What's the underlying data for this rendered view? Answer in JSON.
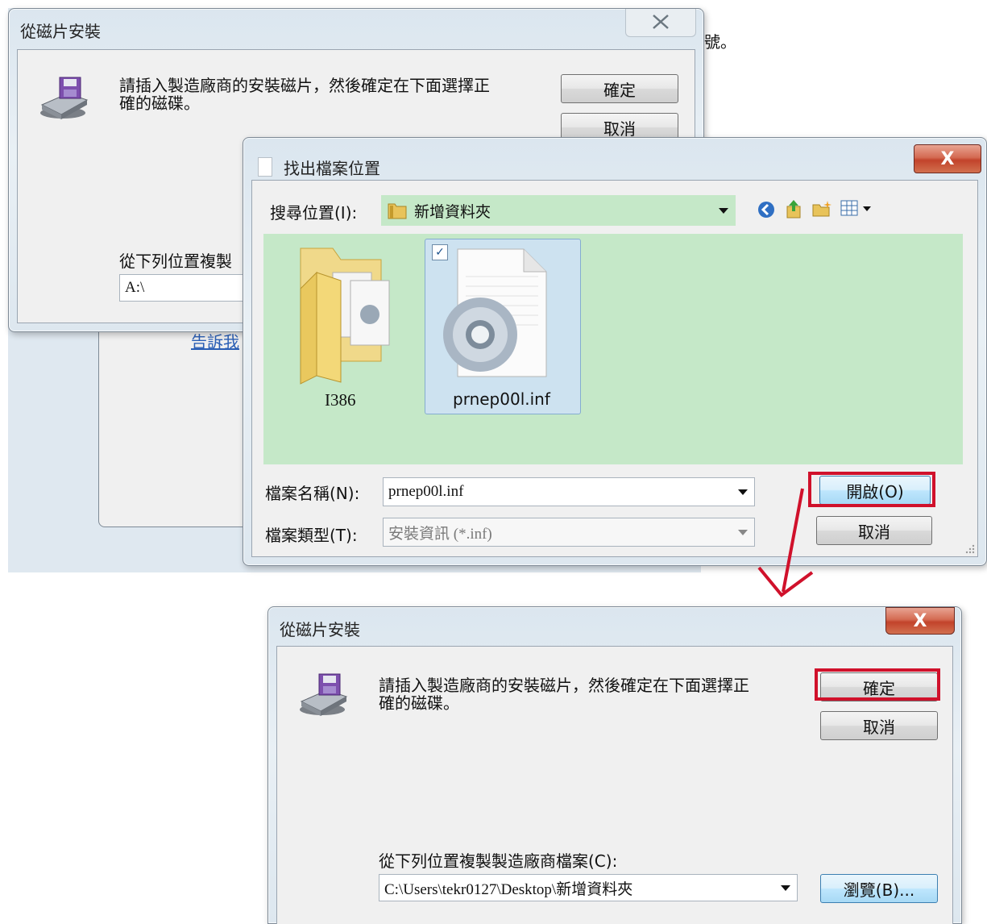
{
  "background_text": "號。",
  "bg_link": "告訴我",
  "dialog_top": {
    "title": "從磁片安裝",
    "message_line1": "請插入製造廠商的安裝磁片，然後確定在下面選擇正",
    "message_line2": "確的磁碟。",
    "ok_label": "確定",
    "cancel_label": "取消",
    "copy_label": "從下列位置複製",
    "copy_value": "A:\\"
  },
  "file_dialog": {
    "title": "找出檔案位置",
    "lookin_label": "搜尋位置(I):",
    "lookin_value": "新增資料夾",
    "items": [
      {
        "name": "I386",
        "type": "folder"
      },
      {
        "name": "prnep00l.inf",
        "type": "inf-file",
        "selected": true
      }
    ],
    "filename_label": "檔案名稱(N):",
    "filename_value": "prnep00l.inf",
    "filetype_label": "檔案類型(T):",
    "filetype_value": "安裝資訊 (*.inf)",
    "open_label": "開啟(O)",
    "cancel_label": "取消",
    "close_glyph": "X"
  },
  "dialog_bottom": {
    "title": "從磁片安裝",
    "message_line1": "請插入製造廠商的安裝磁片，然後確定在下面選擇正",
    "message_line2": "確的磁碟。",
    "ok_label": "確定",
    "cancel_label": "取消",
    "copy_label": "從下列位置複製製造廠商檔案(C):",
    "copy_value": "C:\\Users\\tekr0127\\Desktop\\新增資料夾",
    "browse_label": "瀏覽(B)...",
    "close_glyph": "X"
  },
  "colors": {
    "highlight_red": "#d0112b",
    "view_green": "#c5e8c8",
    "arrow_red": "#d0112b"
  }
}
